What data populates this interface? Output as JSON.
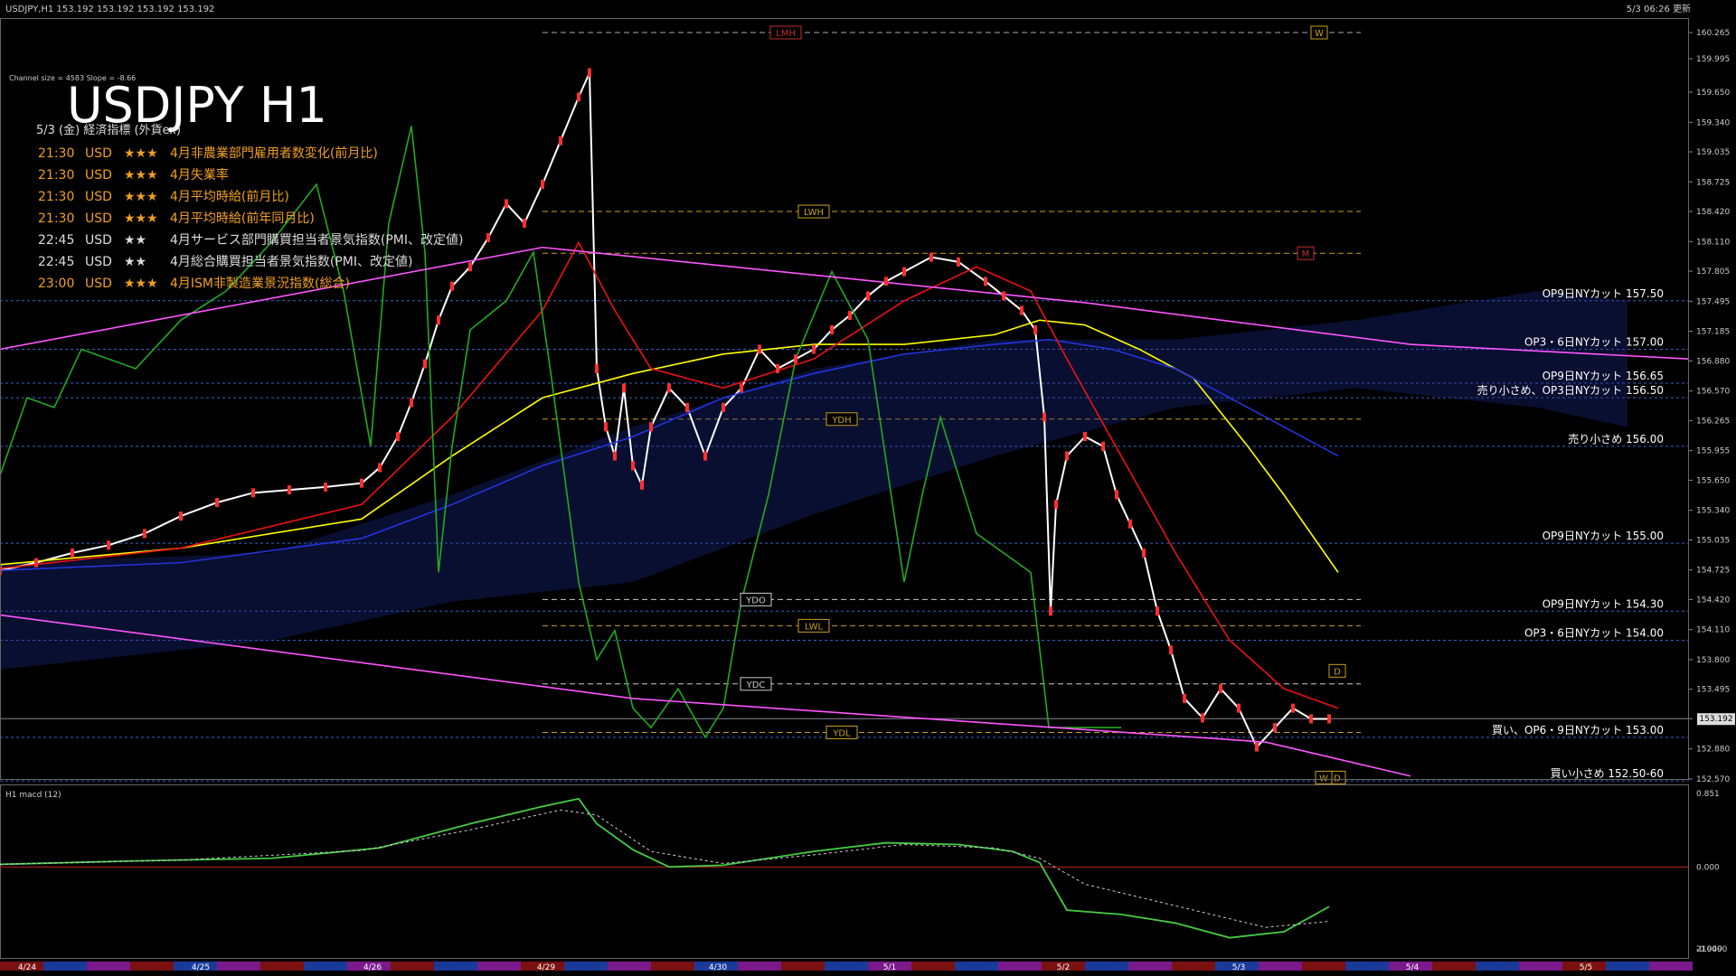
{
  "window": {
    "title": "USDJPY,H1  153.192 153.192 153.192 153.192",
    "server_time": "5/3 06:26 更新"
  },
  "channel_info": "Channel size = 4583 Slope = -8.66",
  "headline": "USDJPY H1",
  "events_header": "5/3 (金) 経済指標 (外貨ex)",
  "events": [
    {
      "time": "21:30",
      "cur": "USD",
      "stars": "★★★",
      "name": "4月非農業部門雇用者数変化(前月比)",
      "color": "#f0a020"
    },
    {
      "time": "21:30",
      "cur": "USD",
      "stars": "★★★",
      "name": "4月失業率",
      "color": "#f0a020"
    },
    {
      "time": "21:30",
      "cur": "USD",
      "stars": "★★★",
      "name": "4月平均時給(前月比)",
      "color": "#f0a020"
    },
    {
      "time": "21:30",
      "cur": "USD",
      "stars": "★★★",
      "name": "4月平均時給(前年同月比)",
      "color": "#f0a020"
    },
    {
      "time": "22:45",
      "cur": "USD",
      "stars": "★★",
      "name": "4月サービス部門購買担当者景気指数(PMI、改定値)",
      "color": "#dddddd"
    },
    {
      "time": "22:45",
      "cur": "USD",
      "stars": "★★",
      "name": "4月総合購買担当者景気指数(PMI、改定値)",
      "color": "#dddddd"
    },
    {
      "time": "23:00",
      "cur": "USD",
      "stars": "★★★",
      "name": "4月ISM非製造業景況指数(総合)",
      "color": "#f0a020"
    }
  ],
  "chart_data": {
    "type": "line",
    "symbol": "USDJPY",
    "timeframe": "H1",
    "ylim": [
      152.57,
      160.265
    ],
    "y_ticks": [
      160.265,
      159.995,
      159.65,
      159.34,
      159.035,
      158.725,
      158.42,
      158.11,
      157.805,
      157.495,
      157.185,
      156.88,
      156.57,
      156.265,
      155.955,
      155.65,
      155.34,
      155.035,
      154.725,
      154.42,
      154.11,
      153.8,
      153.495,
      153.192,
      152.88,
      152.57
    ],
    "current_price": 153.192,
    "x_labels": [
      "4/24",
      "4/25",
      "4/26",
      "4/29",
      "4/30",
      "5/1",
      "5/2",
      "5/3",
      "5/4",
      "5/5"
    ],
    "levels": [
      {
        "label": "OP9日NYカット 157.50",
        "value": 157.5
      },
      {
        "label": "OP3・6日NYカット 157.00",
        "value": 157.0
      },
      {
        "label": "OP9日NYカット 156.65",
        "value": 156.65
      },
      {
        "label": "売り小さめ、OP3日NYカット 156.50",
        "value": 156.5
      },
      {
        "label": "売り小さめ 156.00",
        "value": 156.0
      },
      {
        "label": "OP9日NYカット 155.00",
        "value": 155.0
      },
      {
        "label": "OP9日NYカット 154.30",
        "value": 154.3
      },
      {
        "label": "OP3・6日NYカット 154.00",
        "value": 154.0
      },
      {
        "label": "買い、OP6・9日NYカット 153.00",
        "value": 153.0
      },
      {
        "label": "買い小さめ 152.50-60",
        "value": 152.55
      }
    ],
    "ref_boxes": [
      "LMH",
      "W",
      "LWH",
      "M",
      "YDH",
      "YDO",
      "LWL",
      "YDC",
      "YDL",
      "D",
      "D",
      "W"
    ],
    "ref_levels": {
      "LMH": 160.265,
      "LWH": 158.42,
      "M": 157.99,
      "YDH": 156.28,
      "YDO": 154.42,
      "LWL": 154.15,
      "YDC": 153.55,
      "YDL": 153.05
    },
    "series": [
      {
        "name": "USDJPY",
        "color": "#ffffff",
        "points": [
          [
            0,
            154.72
          ],
          [
            40,
            154.8
          ],
          [
            80,
            154.9
          ],
          [
            120,
            154.98
          ],
          [
            160,
            155.1
          ],
          [
            200,
            155.28
          ],
          [
            240,
            155.42
          ],
          [
            280,
            155.52
          ],
          [
            320,
            155.55
          ],
          [
            360,
            155.58
          ],
          [
            400,
            155.62
          ],
          [
            420,
            155.78
          ],
          [
            440,
            156.1
          ],
          [
            455,
            156.45
          ],
          [
            470,
            156.85
          ],
          [
            485,
            157.3
          ],
          [
            500,
            157.65
          ],
          [
            520,
            157.85
          ],
          [
            540,
            158.15
          ],
          [
            560,
            158.5
          ],
          [
            580,
            158.3
          ],
          [
            600,
            158.7
          ],
          [
            620,
            159.15
          ],
          [
            640,
            159.6
          ],
          [
            652,
            159.85
          ],
          [
            660,
            156.8
          ],
          [
            670,
            156.2
          ],
          [
            680,
            155.9
          ],
          [
            690,
            156.6
          ],
          [
            700,
            155.8
          ],
          [
            710,
            155.6
          ],
          [
            720,
            156.2
          ],
          [
            740,
            156.6
          ],
          [
            760,
            156.4
          ],
          [
            780,
            155.9
          ],
          [
            800,
            156.4
          ],
          [
            820,
            156.6
          ],
          [
            840,
            157.0
          ],
          [
            860,
            156.8
          ],
          [
            880,
            156.9
          ],
          [
            900,
            157.0
          ],
          [
            920,
            157.2
          ],
          [
            940,
            157.35
          ],
          [
            960,
            157.55
          ],
          [
            980,
            157.7
          ],
          [
            1000,
            157.8
          ],
          [
            1030,
            157.95
          ],
          [
            1060,
            157.9
          ],
          [
            1090,
            157.7
          ],
          [
            1110,
            157.55
          ],
          [
            1130,
            157.4
          ],
          [
            1145,
            157.2
          ],
          [
            1155,
            156.3
          ],
          [
            1162,
            154.3
          ],
          [
            1168,
            155.4
          ],
          [
            1180,
            155.9
          ],
          [
            1200,
            156.1
          ],
          [
            1220,
            156.0
          ],
          [
            1235,
            155.5
          ],
          [
            1250,
            155.2
          ],
          [
            1265,
            154.9
          ],
          [
            1280,
            154.3
          ],
          [
            1295,
            153.9
          ],
          [
            1310,
            153.4
          ],
          [
            1330,
            153.2
          ],
          [
            1350,
            153.5
          ],
          [
            1370,
            153.3
          ],
          [
            1390,
            152.9
          ],
          [
            1410,
            153.1
          ],
          [
            1430,
            153.3
          ],
          [
            1450,
            153.19
          ],
          [
            1470,
            153.19
          ]
        ]
      },
      {
        "name": "",
        "color": "#ffff00",
        "points": [
          [
            0,
            154.78
          ],
          [
            200,
            154.95
          ],
          [
            400,
            155.25
          ],
          [
            500,
            155.9
          ],
          [
            600,
            156.5
          ],
          [
            700,
            156.75
          ],
          [
            800,
            156.95
          ],
          [
            900,
            157.05
          ],
          [
            1000,
            157.05
          ],
          [
            1100,
            157.15
          ],
          [
            1150,
            157.3
          ],
          [
            1200,
            157.25
          ],
          [
            1260,
            157.0
          ],
          [
            1320,
            156.7
          ],
          [
            1380,
            156.0
          ],
          [
            1420,
            155.5
          ],
          [
            1480,
            154.7
          ]
        ]
      },
      {
        "name": "",
        "color": "#2233dd",
        "points": [
          [
            0,
            154.72
          ],
          [
            200,
            154.8
          ],
          [
            400,
            155.05
          ],
          [
            500,
            155.4
          ],
          [
            600,
            155.8
          ],
          [
            700,
            156.1
          ],
          [
            800,
            156.5
          ],
          [
            900,
            156.75
          ],
          [
            1000,
            156.95
          ],
          [
            1100,
            157.05
          ],
          [
            1160,
            157.1
          ],
          [
            1230,
            157.0
          ],
          [
            1300,
            156.8
          ],
          [
            1360,
            156.5
          ],
          [
            1420,
            156.2
          ],
          [
            1480,
            155.9
          ]
        ]
      },
      {
        "name": "",
        "color": "#ee1111",
        "points": [
          [
            0,
            154.74
          ],
          [
            200,
            154.95
          ],
          [
            400,
            155.4
          ],
          [
            500,
            156.3
          ],
          [
            600,
            157.4
          ],
          [
            640,
            158.1
          ],
          [
            680,
            157.4
          ],
          [
            720,
            156.8
          ],
          [
            800,
            156.6
          ],
          [
            900,
            156.9
          ],
          [
            1000,
            157.5
          ],
          [
            1080,
            157.85
          ],
          [
            1140,
            157.6
          ],
          [
            1180,
            156.9
          ],
          [
            1240,
            155.9
          ],
          [
            1300,
            154.9
          ],
          [
            1360,
            154.0
          ],
          [
            1420,
            153.5
          ],
          [
            1480,
            153.3
          ]
        ]
      },
      {
        "name": "",
        "color": "#22aa22",
        "points": [
          [
            0,
            155.7
          ],
          [
            30,
            156.5
          ],
          [
            60,
            156.4
          ],
          [
            90,
            157.0
          ],
          [
            150,
            156.8
          ],
          [
            200,
            157.3
          ],
          [
            250,
            157.6
          ],
          [
            300,
            158.1
          ],
          [
            350,
            158.7
          ],
          [
            380,
            157.6
          ],
          [
            410,
            156.0
          ],
          [
            430,
            158.3
          ],
          [
            455,
            159.3
          ],
          [
            470,
            158.0
          ],
          [
            485,
            154.7
          ],
          [
            500,
            156.0
          ],
          [
            520,
            157.2
          ],
          [
            560,
            157.5
          ],
          [
            590,
            158.0
          ],
          [
            610,
            156.7
          ],
          [
            640,
            154.6
          ],
          [
            660,
            153.8
          ],
          [
            680,
            154.1
          ],
          [
            700,
            153.3
          ],
          [
            720,
            153.1
          ],
          [
            750,
            153.5
          ],
          [
            780,
            153.0
          ],
          [
            800,
            153.3
          ],
          [
            820,
            154.4
          ],
          [
            850,
            155.5
          ],
          [
            880,
            156.9
          ],
          [
            920,
            157.8
          ],
          [
            960,
            157.1
          ],
          [
            1000,
            154.6
          ],
          [
            1020,
            155.5
          ],
          [
            1040,
            156.3
          ],
          [
            1080,
            155.1
          ],
          [
            1110,
            154.9
          ],
          [
            1140,
            154.7
          ],
          [
            1160,
            153.1
          ],
          [
            1200,
            153.1
          ],
          [
            1240,
            153.1
          ]
        ]
      },
      {
        "name": "",
        "color": "#ff55ff",
        "points": [
          [
            0,
            157.0
          ],
          [
            600,
            158.05
          ],
          [
            1200,
            157.48
          ],
          [
            1560,
            157.05
          ],
          [
            1868,
            156.9
          ]
        ]
      },
      {
        "name": "",
        "color": "#ff55ff",
        "points": [
          [
            0,
            154.26
          ],
          [
            700,
            153.4
          ],
          [
            1400,
            152.95
          ],
          [
            1560,
            152.6
          ]
        ]
      }
    ],
    "macd": {
      "title": "H1  macd (12)",
      "ylim": [
        -0.949,
        0.851
      ],
      "ticks": [
        0.851,
        0.0,
        -0.949
      ],
      "right_tick_extra": "210000",
      "macd_line": [
        [
          0,
          0.03
        ],
        [
          150,
          0.07
        ],
        [
          300,
          0.1
        ],
        [
          420,
          0.22
        ],
        [
          520,
          0.5
        ],
        [
          600,
          0.7
        ],
        [
          640,
          0.79
        ],
        [
          660,
          0.5
        ],
        [
          700,
          0.2
        ],
        [
          740,
          0.0
        ],
        [
          800,
          0.02
        ],
        [
          900,
          0.18
        ],
        [
          980,
          0.28
        ],
        [
          1060,
          0.26
        ],
        [
          1120,
          0.18
        ],
        [
          1150,
          0.05
        ],
        [
          1180,
          -0.5
        ],
        [
          1240,
          -0.55
        ],
        [
          1300,
          -0.65
        ],
        [
          1360,
          -0.82
        ],
        [
          1420,
          -0.75
        ],
        [
          1470,
          -0.46
        ]
      ],
      "signal_line": [
        [
          0,
          0.03
        ],
        [
          200,
          0.08
        ],
        [
          400,
          0.19
        ],
        [
          520,
          0.43
        ],
        [
          620,
          0.66
        ],
        [
          660,
          0.6
        ],
        [
          720,
          0.18
        ],
        [
          800,
          0.04
        ],
        [
          900,
          0.14
        ],
        [
          1000,
          0.26
        ],
        [
          1100,
          0.22
        ],
        [
          1150,
          0.1
        ],
        [
          1200,
          -0.2
        ],
        [
          1300,
          -0.45
        ],
        [
          1400,
          -0.7
        ],
        [
          1470,
          -0.63
        ]
      ]
    }
  }
}
